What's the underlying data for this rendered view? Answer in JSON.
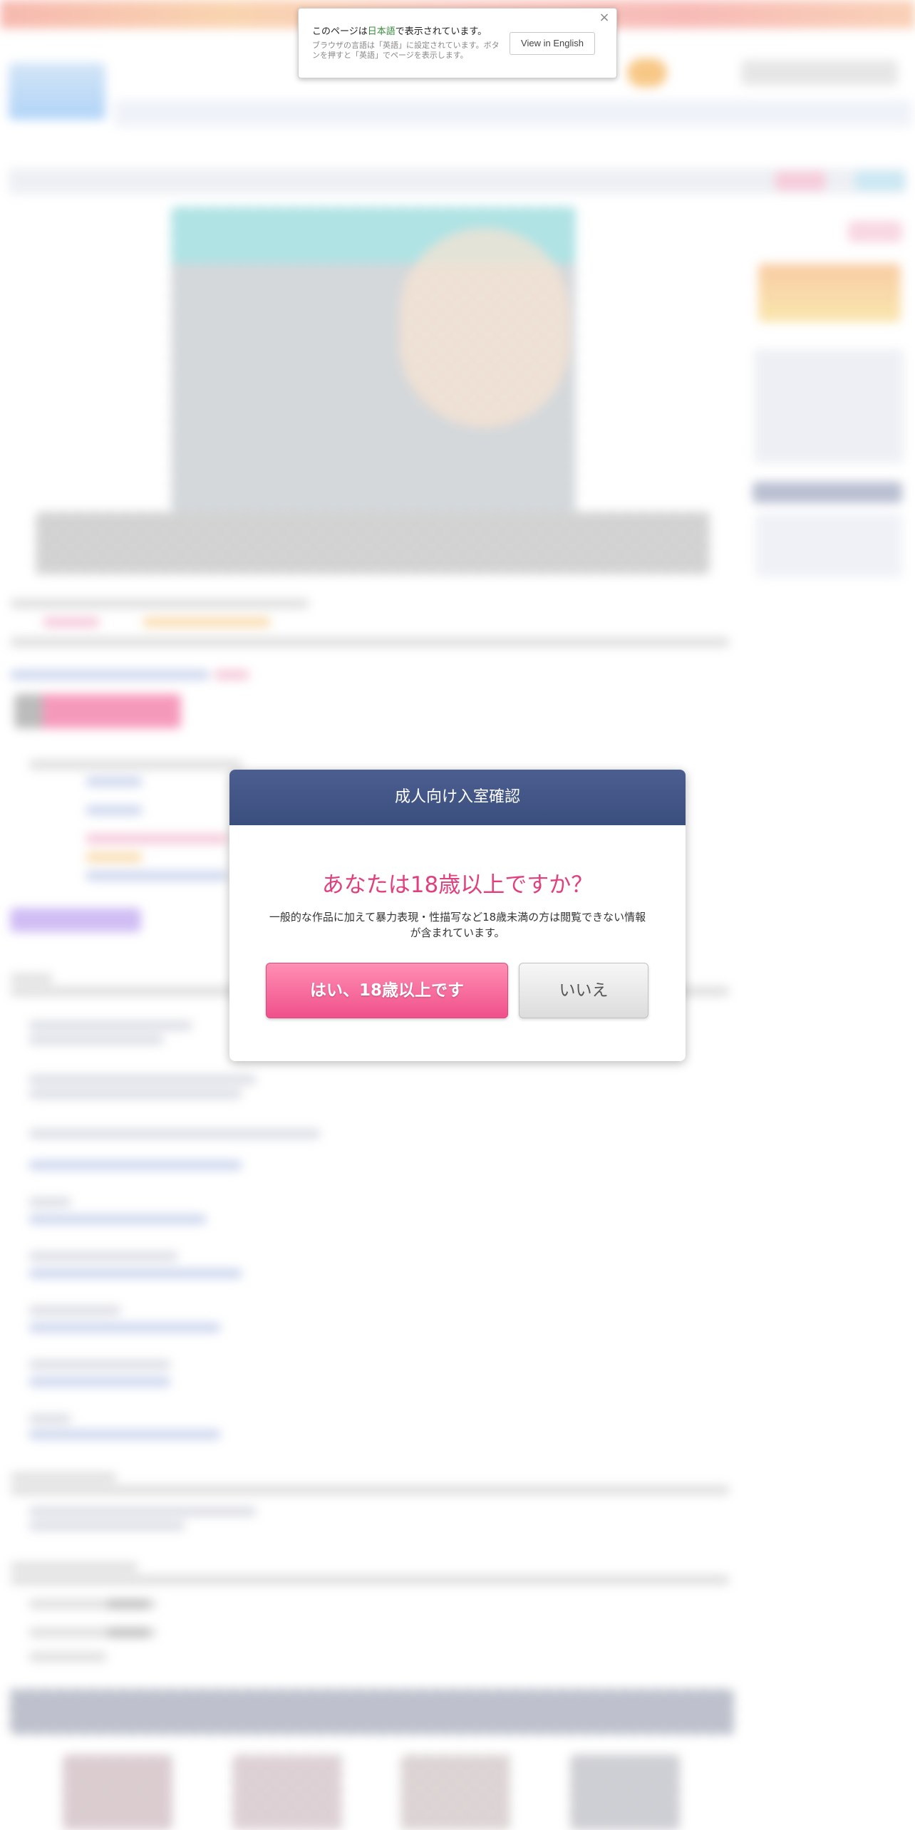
{
  "translate_bar": {
    "message_prefix": "このページは",
    "language": "日本語",
    "message_suffix": "で表示されています。",
    "sub_message": "ブラウザの言語は「英語」に設定されています。ボタンを押すと「英語」でページを表示します。",
    "button_label": "View in English",
    "close_glyph": "×"
  },
  "age_modal": {
    "header": "成人向け入室確認",
    "question": "あなたは18歳以上ですか？",
    "description": "一般的な作品に加えて暴力表現・性描写など18歳未満の方は閲覧できない情報が含まれています。",
    "yes_label": "はい、18歳以上です",
    "no_label": "いいえ"
  },
  "colors": {
    "modal_header": "#40547f",
    "question_text": "#e0407e",
    "yes_button": "#f0508a",
    "no_button": "#e6e6e6",
    "language_highlight": "#3a8b3f"
  },
  "icons": {
    "translate_close": "close-icon"
  }
}
